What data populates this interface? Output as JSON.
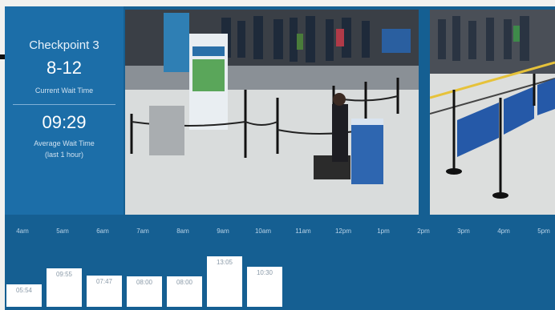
{
  "panel": {
    "checkpoint": "Checkpoint 3",
    "current_wait": "8-12",
    "current_wait_label": "Current Wait Time",
    "average_wait": "09:29",
    "average_wait_label": "Average Wait Time",
    "average_wait_sub": "(last 1 hour)"
  },
  "chart_data": {
    "type": "bar",
    "categories": [
      "4am",
      "5am",
      "6am",
      "7am",
      "8am",
      "9am",
      "10am",
      "11am",
      "12pm",
      "1pm",
      "2pm",
      "3pm",
      "4pm",
      "5pm"
    ],
    "values": [
      5.9,
      9.92,
      8.07,
      8.0,
      8.0,
      13.1,
      10.5
    ],
    "value_labels": [
      "05:54",
      "09:55",
      "07:47",
      "08:00",
      "08:00",
      "13:05",
      "10:30"
    ],
    "title": "",
    "xlabel": "",
    "ylabel": "",
    "ylim": [
      0,
      15
    ]
  },
  "colors": {
    "panel": "#1c6ea8",
    "chart_bg": "#155f92",
    "bar": "#ffffff"
  }
}
